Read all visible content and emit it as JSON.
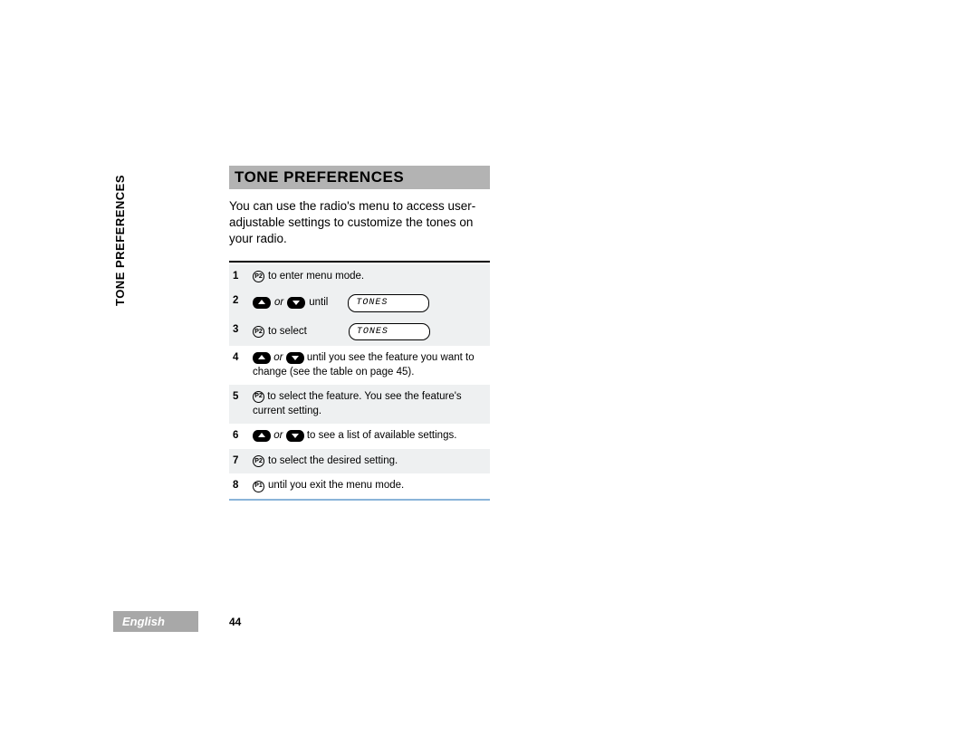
{
  "sideTab": "TONE PREFERENCES",
  "heading": "TONE PREFERENCES",
  "intro": "You can use the radio's menu to access user-adjustable settings to customize the tones on your radio.",
  "steps": {
    "s1": {
      "num": "1",
      "iconLabel": "P2",
      "text": "to enter menu mode."
    },
    "s2": {
      "num": "2",
      "or": "or",
      "until": "until",
      "display": "TONES"
    },
    "s3": {
      "num": "3",
      "iconLabel": "P2",
      "text": "to select",
      "display": "TONES"
    },
    "s4": {
      "num": "4",
      "or": "or",
      "text": "until you see the feature you want to change (see the table on page 45)."
    },
    "s5": {
      "num": "5",
      "iconLabel": "P2",
      "text": "to select the feature. You see the feature's current setting."
    },
    "s6": {
      "num": "6",
      "or": "or",
      "text": "to see a list of available settings."
    },
    "s7": {
      "num": "7",
      "iconLabel": "P2",
      "text": "to select the desired setting."
    },
    "s8": {
      "num": "8",
      "iconLabel": "P1",
      "text": "until you exit the menu mode."
    }
  },
  "pageNumber": "44",
  "language": "English"
}
